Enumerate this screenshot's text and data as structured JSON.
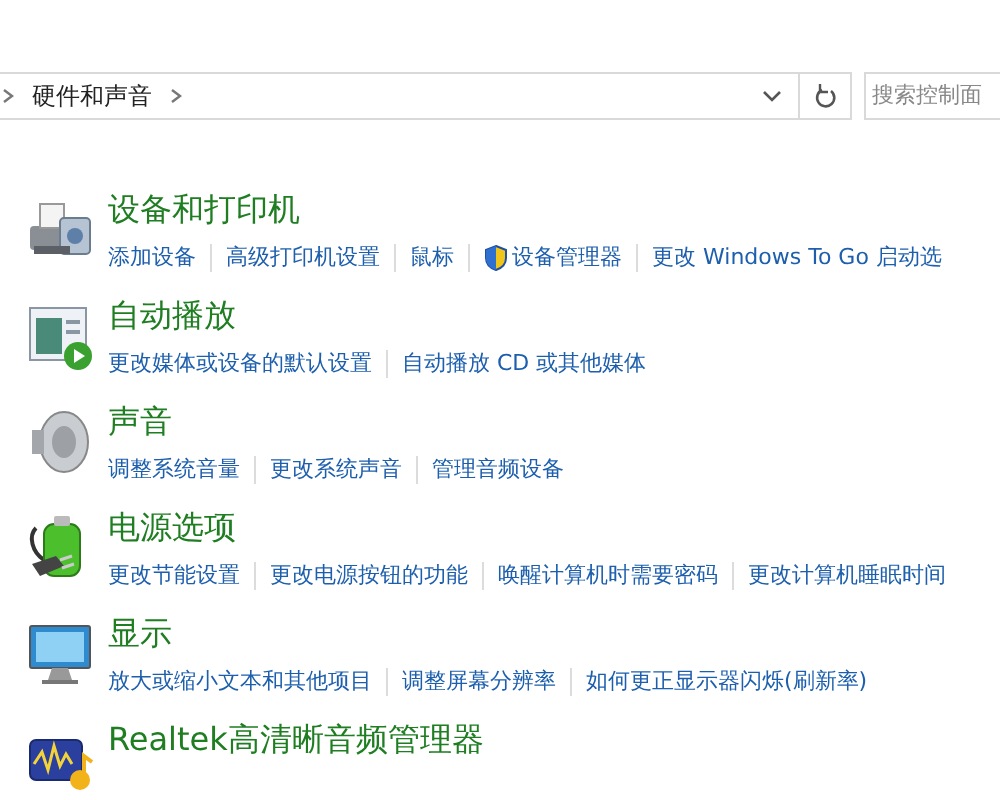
{
  "address_bar": {
    "path": [
      "硬件和声音"
    ],
    "search": {
      "placeholder": "搜索控制面"
    }
  },
  "categories": [
    {
      "title": "设备和打印机",
      "links": [
        {
          "label": "添加设备",
          "shield": false
        },
        {
          "label": "高级打印机设置",
          "shield": false
        },
        {
          "label": "鼠标",
          "shield": false
        },
        {
          "label": "设备管理器",
          "shield": true
        },
        {
          "label": "更改 Windows To Go 启动选",
          "shield": false
        }
      ]
    },
    {
      "title": "自动播放",
      "links": [
        {
          "label": "更改媒体或设备的默认设置",
          "shield": false
        },
        {
          "label": "自动播放 CD 或其他媒体",
          "shield": false
        }
      ]
    },
    {
      "title": "声音",
      "links": [
        {
          "label": "调整系统音量",
          "shield": false
        },
        {
          "label": "更改系统声音",
          "shield": false
        },
        {
          "label": "管理音频设备",
          "shield": false
        }
      ]
    },
    {
      "title": "电源选项",
      "links": [
        {
          "label": "更改节能设置",
          "shield": false
        },
        {
          "label": "更改电源按钮的功能",
          "shield": false
        },
        {
          "label": "唤醒计算机时需要密码",
          "shield": false
        },
        {
          "label": "更改计算机睡眠时间",
          "shield": false
        }
      ]
    },
    {
      "title": "显示",
      "links": [
        {
          "label": "放大或缩小文本和其他项目",
          "shield": false
        },
        {
          "label": "调整屏幕分辨率",
          "shield": false
        },
        {
          "label": "如何更正显示器闪烁(刷新率)",
          "shield": false
        }
      ]
    },
    {
      "title": "Realtek高清晰音频管理器"
    }
  ]
}
